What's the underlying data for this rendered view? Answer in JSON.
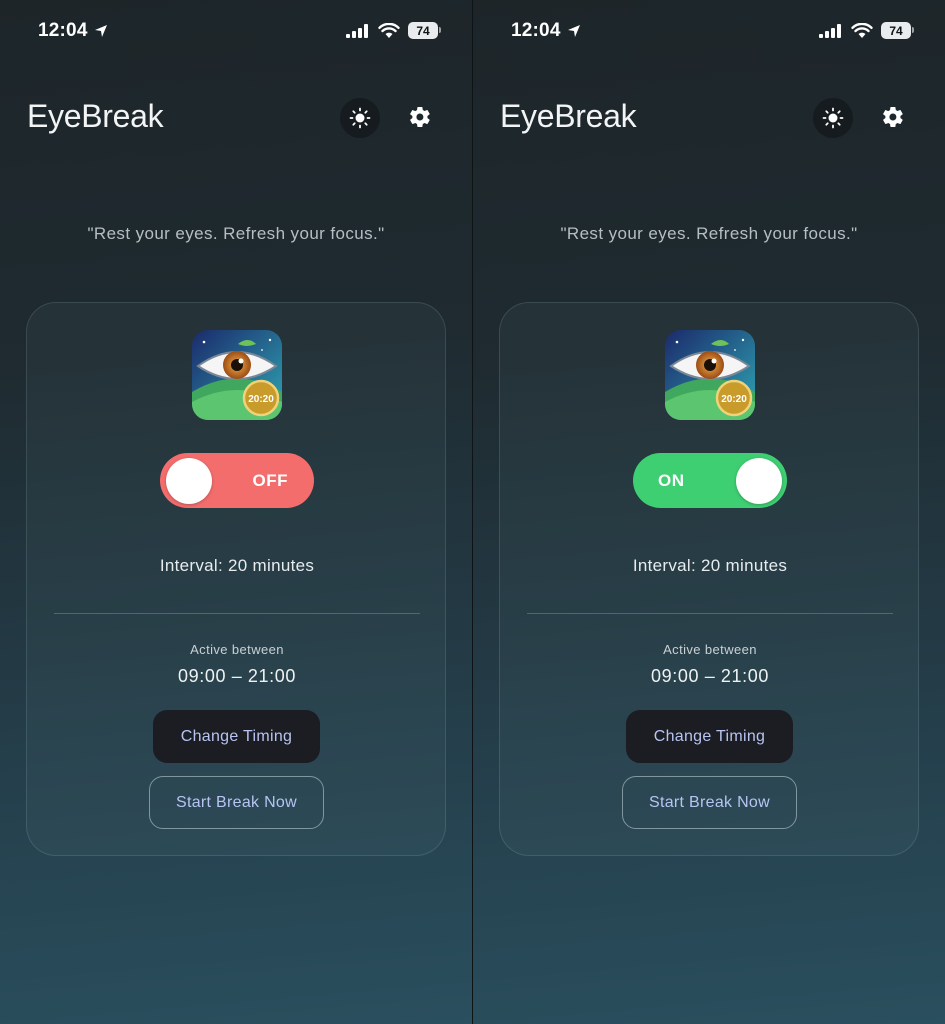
{
  "screens": [
    {
      "status": {
        "time": "12:04",
        "battery": "74"
      },
      "header": {
        "title": "EyeBreak"
      },
      "quote": "\"Rest your eyes. Refresh your focus.\"",
      "card": {
        "icon_badge": "20:20",
        "toggle": {
          "state": "off",
          "label": "OFF",
          "color": "#f46d6d"
        },
        "interval": "Interval: 20 minutes",
        "active_label": "Active between",
        "active_range": "09:00 – 21:00",
        "change_timing_label": "Change Timing",
        "start_break_label": "Start Break Now"
      }
    },
    {
      "status": {
        "time": "12:04",
        "battery": "74"
      },
      "header": {
        "title": "EyeBreak"
      },
      "quote": "\"Rest your eyes. Refresh your focus.\"",
      "card": {
        "icon_badge": "20:20",
        "toggle": {
          "state": "on",
          "label": "ON",
          "color": "#3ecf72"
        },
        "interval": "Interval: 20 minutes",
        "active_label": "Active between",
        "active_range": "09:00 – 21:00",
        "change_timing_label": "Change Timing",
        "start_break_label": "Start Break Now"
      }
    }
  ],
  "icons": {
    "location": "location-arrow-icon",
    "signal": "cellular-signal-icon",
    "wifi": "wifi-icon",
    "theme": "sun-icon",
    "settings": "gear-icon"
  }
}
